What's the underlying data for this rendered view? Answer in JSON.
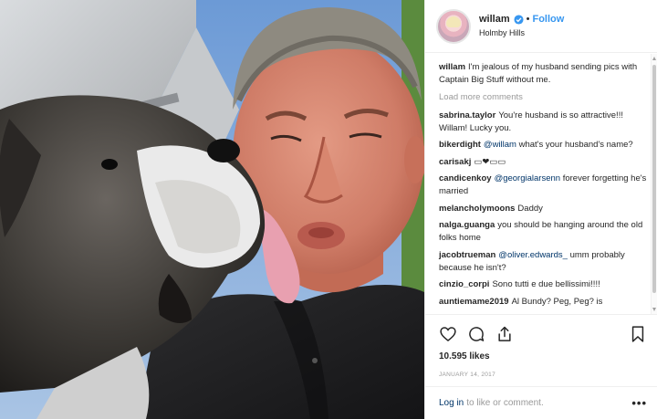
{
  "post": {
    "username": "willam",
    "follow_label": "Follow",
    "separator": "•",
    "location": "Holmby Hills"
  },
  "caption": {
    "author": "willam",
    "text": "I'm jealous of my husband sending pics with Captain Big Stuff without me."
  },
  "load_more_label": "Load more comments",
  "comments": [
    {
      "author": "sabrina.taylor",
      "mention": "",
      "text": "You're husband is so attractive!!! Willam! Lucky you."
    },
    {
      "author": "bikerdight",
      "mention": "@willam",
      "text": "what's your husband's name?"
    },
    {
      "author": "carisakj",
      "mention": "",
      "text": "▭❤▭▭"
    },
    {
      "author": "candicenkoy",
      "mention": "@georgialarsenn",
      "text": "forever forgetting he's married"
    },
    {
      "author": "melancholymoons",
      "mention": "",
      "text": "Daddy"
    },
    {
      "author": "nalga.guanga",
      "mention": "",
      "text": "you should be hanging around the old folks home"
    },
    {
      "author": "jacobtrueman",
      "mention": "@oliver.edwards_",
      "text": "umm probably because he isn't?"
    },
    {
      "author": "cinzio_corpi",
      "mention": "",
      "text": "Sono tutti e due bellissimi!!!!"
    },
    {
      "author": "auntiemame2019",
      "mention": "",
      "text": "Al Bundy? Peg, Peg? is"
    }
  ],
  "stats": {
    "likes": "10.595 likes",
    "date": "JANUARY 14, 2017"
  },
  "footer": {
    "login_label": "Log in",
    "login_suffix": "to like or comment.",
    "more_label": "•••"
  },
  "icons": {
    "verified": "verified-badge-icon",
    "like": "heart-icon",
    "comment": "comment-bubble-icon",
    "share": "share-arrow-icon",
    "save": "bookmark-icon",
    "more": "more-options-icon"
  },
  "colors": {
    "link": "#3897f0",
    "mention": "#003569",
    "muted": "#999999",
    "text": "#262626"
  }
}
